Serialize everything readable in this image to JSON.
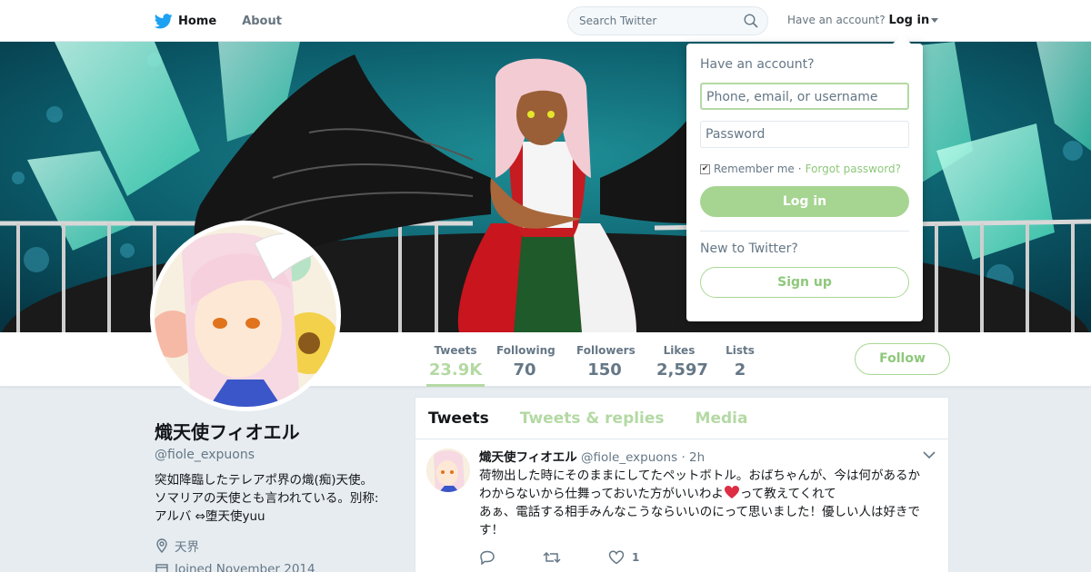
{
  "nav": {
    "home_label": "Home",
    "about_label": "About",
    "search_placeholder": "Search Twitter",
    "have_account": "Have an account?",
    "login_label": "Log in"
  },
  "profile": {
    "name": "熾天使フィオエル",
    "handle": "@fiole_expuons",
    "bio_line1": "突如降臨したテレアポ界の熾(痴)天使。",
    "bio_line2": "ソマリアの天使とも言われている。別称:",
    "bio_line3": "アルバ ⇔堕天使yuu",
    "location": "天界",
    "joined": "Joined November 2014"
  },
  "stats": [
    {
      "label": "Tweets",
      "value": "23.9K"
    },
    {
      "label": "Following",
      "value": "70"
    },
    {
      "label": "Followers",
      "value": "150"
    },
    {
      "label": "Likes",
      "value": "2,597"
    },
    {
      "label": "Lists",
      "value": "2"
    }
  ],
  "follow_label": "Follow",
  "timeline": {
    "tabs": [
      "Tweets",
      "Tweets & replies",
      "Media"
    ],
    "tweet": {
      "name": "熾天使フィオエル",
      "handle": "@fiole_expuons",
      "time": "· 2h",
      "line1": "荷物出した時にそのままにしてたペットボトル。おばちゃんが、今は何があるか",
      "line2a": "わからないから仕舞っておいた方がいいわよ",
      "line2b": "って教えてくれて",
      "line3": "あぁ、電話する相手みんなこうならいいのにって思いました！優しい人は好きで",
      "line4": "す！",
      "like_count": "1"
    }
  },
  "login_dropdown": {
    "title": "Have an account?",
    "username_placeholder": "Phone, email, or username",
    "password_placeholder": "Password",
    "remember_label": "Remember me",
    "separator": "·",
    "forgot_label": "Forgot password?",
    "login_button": "Log in",
    "new_to_twitter": "New to Twitter?",
    "signup_button": "Sign up"
  },
  "colors": {
    "accent": "#b4d9a4",
    "twitter_blue": "#1da1f2",
    "muted": "#657786"
  },
  "icons": [
    "twitter-bird-icon",
    "home-icon",
    "search-icon",
    "location-icon",
    "calendar-icon",
    "reply-icon",
    "retweet-icon",
    "heart-icon",
    "chevron-down-icon"
  ]
}
